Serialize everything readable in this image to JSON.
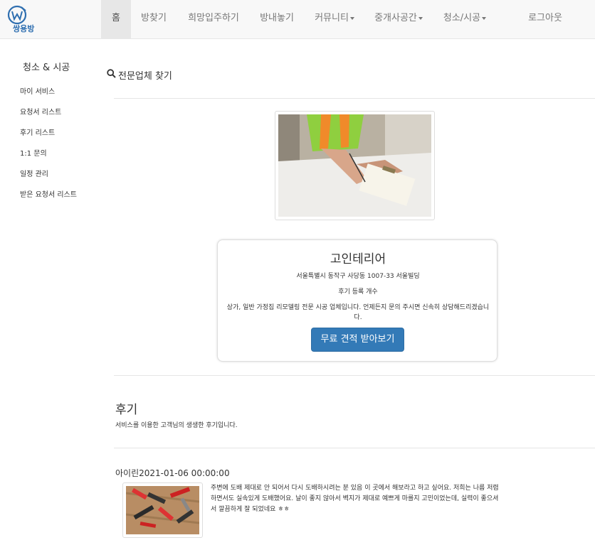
{
  "nav": {
    "logo_text": "쌍용방",
    "items": [
      {
        "label": "홈"
      },
      {
        "label": "방찾기"
      },
      {
        "label": "희망입주하기"
      },
      {
        "label": "방내놓기"
      },
      {
        "label": "커뮤니티"
      },
      {
        "label": "중개사공간"
      },
      {
        "label": "청소/시공"
      }
    ],
    "logout_label": "로그아웃"
  },
  "sidebar": {
    "title": "청소 & 시공",
    "links": [
      {
        "label": "마이 서비스"
      },
      {
        "label": "요청서 리스트"
      },
      {
        "label": "후기 리스트"
      },
      {
        "label": "1:1 문의"
      },
      {
        "label": "일정 관리"
      },
      {
        "label": "받은 요청서 리스트"
      }
    ]
  },
  "main": {
    "section_title": "전문업체 찾기",
    "company": {
      "name": "고인테리어",
      "address": "서울특별시 동작구 사당동 1007-33 서울빌딩",
      "review_count_label": "후기 등록 개수",
      "description": "상가, 일반 가정집 리모델링 전문 시공 업체입니다. 언제든지 문의 주시면 신속히 상담해드리겠습니다.",
      "quote_button": "무료 견적 받아보기"
    },
    "reviews": {
      "title": "후기",
      "subtitle": "서비스를 이용한 고객님의 생생한 후기입니다.",
      "items": [
        {
          "author": "아이린",
          "date": "2021-01-06 00:00:00",
          "text": "주변에 도배 제대로 안 되어서 다시 도배하시려는 분 있음 이 곳에서 해보라고 하고 싶어요. 저희는 나름 저렴하면서도 실속있게 도배했어요. 날이 좋지 않아서 벽지가 제대로 예쁘게 마를지 고민이었는데, 실력이 좋으셔서 깔끔하게 잘 되었네요 ㅎㅎ"
        }
      ]
    }
  },
  "colors": {
    "primary_button": "#337ab7",
    "navbar_bg": "#f8f8f8",
    "logo_blue": "#2f6fb0"
  },
  "icons": {
    "search": "search-icon",
    "logo": "house-logo-icon"
  }
}
